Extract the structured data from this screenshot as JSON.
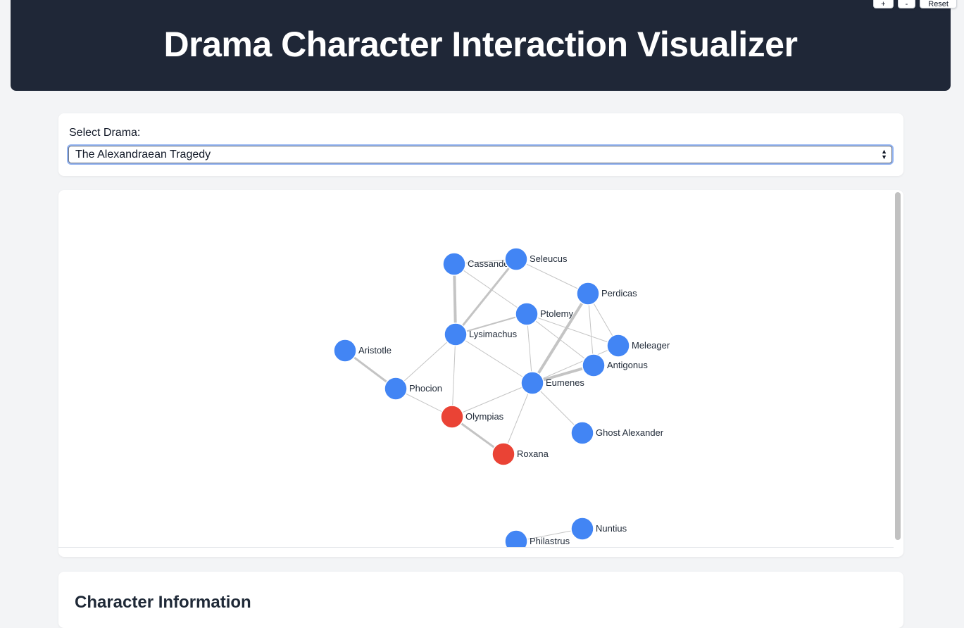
{
  "zoom": {
    "plus_label": "+",
    "minus_label": "-",
    "reset_label": "Reset"
  },
  "header": {
    "title": "Drama Character Interaction Visualizer"
  },
  "drama_select": {
    "label": "Select Drama:",
    "selected": "The Alexandraean Tragedy"
  },
  "graph": {
    "colors": {
      "default_node": "#4285f4",
      "female_node": "#ea4335",
      "edge": "#c4c4c4"
    },
    "nodes": [
      {
        "id": "Cassander",
        "group": "default"
      },
      {
        "id": "Seleucus",
        "group": "default"
      },
      {
        "id": "Perdicas",
        "group": "default"
      },
      {
        "id": "Ptolemy",
        "group": "default"
      },
      {
        "id": "Lysimachus",
        "group": "default"
      },
      {
        "id": "Aristotle",
        "group": "default"
      },
      {
        "id": "Meleager",
        "group": "default"
      },
      {
        "id": "Antigonus",
        "group": "default"
      },
      {
        "id": "Phocion",
        "group": "default"
      },
      {
        "id": "Eumenes",
        "group": "default"
      },
      {
        "id": "Olympias",
        "group": "female"
      },
      {
        "id": "Ghost Alexander",
        "group": "default"
      },
      {
        "id": "Roxana",
        "group": "female"
      },
      {
        "id": "Nuntius",
        "group": "default"
      },
      {
        "id": "Philastrus",
        "group": "default"
      }
    ],
    "edges": [
      {
        "source": "Cassander",
        "target": "Lysimachus",
        "weight": 4
      },
      {
        "source": "Cassander",
        "target": "Seleucus",
        "weight": 1
      },
      {
        "source": "Cassander",
        "target": "Ptolemy",
        "weight": 1
      },
      {
        "source": "Seleucus",
        "target": "Lysimachus",
        "weight": 3
      },
      {
        "source": "Seleucus",
        "target": "Perdicas",
        "weight": 1
      },
      {
        "source": "Perdicas",
        "target": "Eumenes",
        "weight": 4
      },
      {
        "source": "Perdicas",
        "target": "Meleager",
        "weight": 1
      },
      {
        "source": "Perdicas",
        "target": "Antigonus",
        "weight": 1
      },
      {
        "source": "Ptolemy",
        "target": "Lysimachus",
        "weight": 2
      },
      {
        "source": "Ptolemy",
        "target": "Eumenes",
        "weight": 1
      },
      {
        "source": "Ptolemy",
        "target": "Meleager",
        "weight": 1
      },
      {
        "source": "Ptolemy",
        "target": "Antigonus",
        "weight": 1
      },
      {
        "source": "Lysimachus",
        "target": "Phocion",
        "weight": 1
      },
      {
        "source": "Lysimachus",
        "target": "Olympias",
        "weight": 1
      },
      {
        "source": "Lysimachus",
        "target": "Eumenes",
        "weight": 1
      },
      {
        "source": "Aristotle",
        "target": "Phocion",
        "weight": 3
      },
      {
        "source": "Meleager",
        "target": "Eumenes",
        "weight": 1
      },
      {
        "source": "Antigonus",
        "target": "Eumenes",
        "weight": 4
      },
      {
        "source": "Phocion",
        "target": "Olympias",
        "weight": 1
      },
      {
        "source": "Eumenes",
        "target": "Olympias",
        "weight": 1
      },
      {
        "source": "Eumenes",
        "target": "Ghost Alexander",
        "weight": 1
      },
      {
        "source": "Eumenes",
        "target": "Roxana",
        "weight": 1
      },
      {
        "source": "Olympias",
        "target": "Roxana",
        "weight": 3
      },
      {
        "source": "Nuntius",
        "target": "Philastrus",
        "weight": 1
      }
    ]
  },
  "info": {
    "heading": "Character Information"
  }
}
